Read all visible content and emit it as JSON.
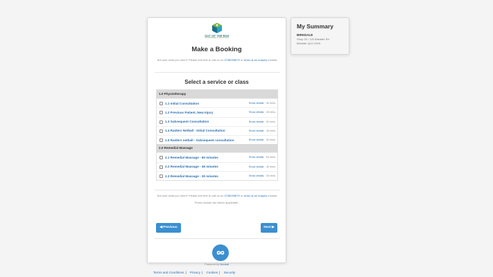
{
  "page": {
    "title": "Make a Booking",
    "note_prefix": "Not sure what you need? Please feel free to call us on",
    "phone": "0738039879",
    "note_or": "or",
    "enquiry_link": "send us an enquiry",
    "note_suffix": "instead.",
    "section_title": "Select a service or class",
    "prices_note": "Prices include tax where applicable."
  },
  "logo": {
    "line1": "OUT OF THE BOX",
    "line2": "Physiotherapy & Sports Injury"
  },
  "groups": [
    {
      "title": "1.0 Physiotherapy",
      "items": [
        {
          "label": "1.1 Initial Consultation",
          "details": "Show details",
          "duration": "45 mins"
        },
        {
          "label": "1.2 Previous Patient, New Injury",
          "details": "Show details",
          "duration": "45 mins"
        },
        {
          "label": "1.3 Subsequent Consultation",
          "details": "Show details",
          "duration": "30 mins"
        },
        {
          "label": "1.4 Raiders Netball - Initial Consultation",
          "details": "Show details",
          "duration": "45 mins"
        },
        {
          "label": "1.5 Raiders netball - Subsequent consultation",
          "details": "Show details",
          "duration": "30 mins"
        }
      ]
    },
    {
      "title": "2.0 Remedial Massage",
      "items": [
        {
          "label": "2.1 Remedial Massage - 60 minutes",
          "details": "Show details",
          "duration": "60 mins"
        },
        {
          "label": "2.2 Remedial Massage - 45 minutes",
          "details": "Show details",
          "duration": "45 mins"
        },
        {
          "label": "2.3 Remedial Massage - 30 minutes",
          "details": "Show details",
          "duration": "30 mins"
        }
      ]
    }
  ],
  "buttons": {
    "previous": "◀ Previous",
    "next": "Next ▶"
  },
  "powered": {
    "prefix": "Powered by",
    "brand": "Nookal"
  },
  "footer": {
    "terms": "Terms and Conditions",
    "privacy": "Privacy",
    "cookies": "Cookies",
    "security": "Security",
    "separator": "|"
  },
  "summary": {
    "title": "My Summary",
    "location": "BIRKDALE",
    "address_line1": "Shop 20 / 120 Birkdale Rd",
    "address_line2": "Birkdale QLD 4159"
  },
  "colors": {
    "accent": "#3b8fd0",
    "link": "#2a6fb0",
    "group_header": "#d9d9d9"
  }
}
